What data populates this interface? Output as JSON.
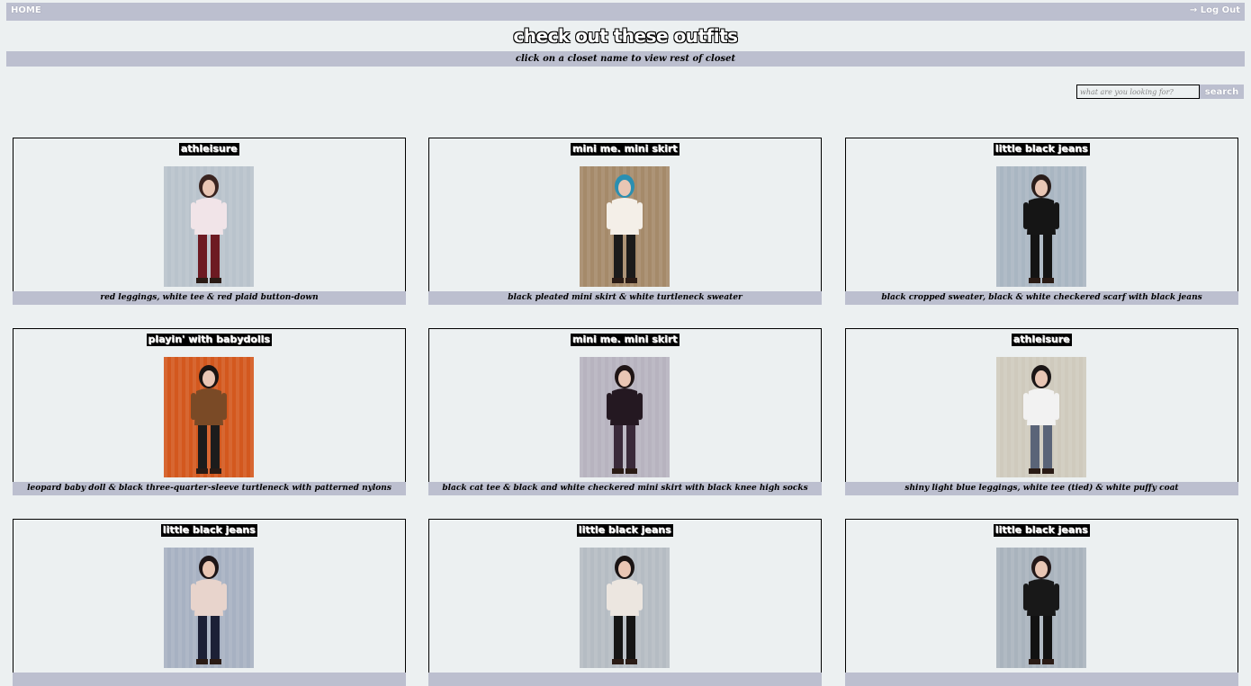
{
  "nav": {
    "home": "HOME",
    "logout": "→ Log Out"
  },
  "header": {
    "title": "check out these outfits",
    "subtitle": "click on a closet name to view rest of closet"
  },
  "search": {
    "placeholder": "what are you looking for?",
    "button": "search"
  },
  "outfits": [
    {
      "closet": "athleisure",
      "caption": "red leggings, white tee & red plaid button-down",
      "bg": "#b9c3cc",
      "top": "#f1e4e8",
      "bottom": "#6d1a22",
      "hair": "#3a2420"
    },
    {
      "closet": "mini me. mini skirt",
      "caption": "black pleated mini skirt & white turtleneck sweater",
      "bg": "#a58a6a",
      "top": "#f4efe8",
      "bottom": "#1b1b1b",
      "hair": "#2b8fb1"
    },
    {
      "closet": "little black jeans",
      "caption": "black cropped sweater, black & white checkered scarf with black jeans",
      "bg": "#a9b6c2",
      "top": "#151515",
      "bottom": "#141414",
      "hair": "#2a1d1a"
    },
    {
      "closet": "playin' with babydolls",
      "caption": "leopard baby doll & black three-quarter-sleeve turtleneck with patterned nylons",
      "bg": "#d3581e",
      "top": "#7a4a26",
      "bottom": "#1c1c1c",
      "hair": "#1a1412"
    },
    {
      "closet": "mini me. mini skirt",
      "caption": "black cat tee & black and white checkered mini skirt with black knee high socks",
      "bg": "#b7b3bf",
      "top": "#241821",
      "bottom": "#3a2a3a",
      "hair": "#1f1515"
    },
    {
      "closet": "athleisure",
      "caption": "shiny light blue leggings, white tee (tied) & white puffy coat",
      "bg": "#cfcabd",
      "top": "#f2f2f2",
      "bottom": "#5a6478",
      "hair": "#1b1616"
    },
    {
      "closet": "little black jeans",
      "caption": "",
      "bg": "#a7b1c2",
      "top": "#e8d4cc",
      "bottom": "#1c2036",
      "hair": "#1d1517"
    },
    {
      "closet": "little black jeans",
      "caption": "",
      "bg": "#b5bcc3",
      "top": "#ece6e0",
      "bottom": "#151515",
      "hair": "#1a1414"
    },
    {
      "closet": "little black jeans",
      "caption": "",
      "bg": "#a9b3bd",
      "top": "#181818",
      "bottom": "#121212",
      "hair": "#231818"
    }
  ]
}
